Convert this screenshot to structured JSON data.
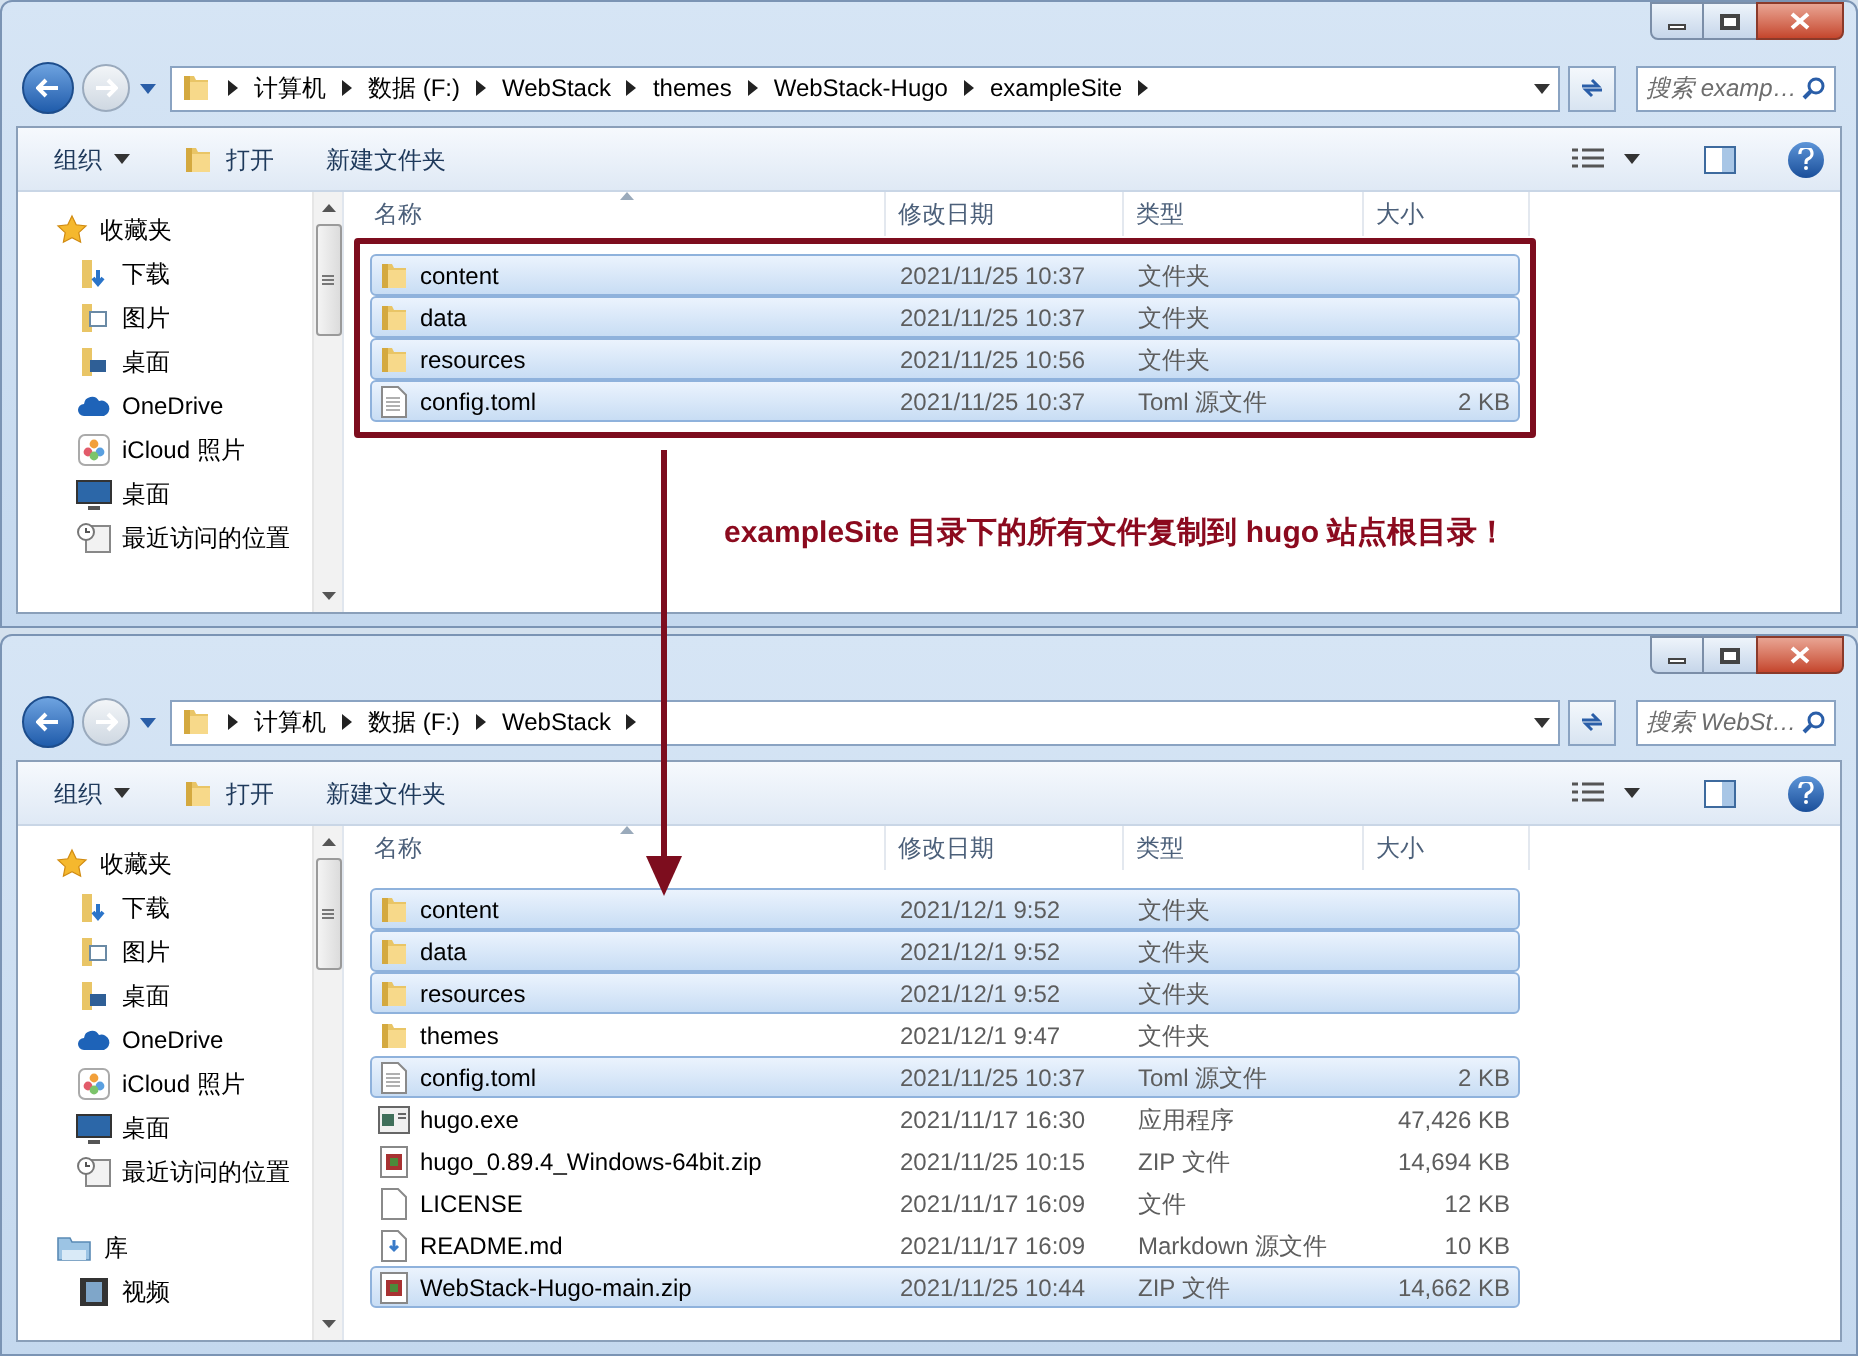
{
  "windows": [
    {
      "breadcrumbs": [
        "计算机",
        "数据 (F:)",
        "WebStack",
        "themes",
        "WebStack-Hugo",
        "exampleSite"
      ],
      "search": {
        "placeholder": "搜索 examp…"
      },
      "toolbar": [
        {
          "label": "组织",
          "kind": "menu"
        },
        {
          "label": "打开",
          "kind": "open"
        },
        {
          "label": "新建文件夹",
          "kind": "plain"
        }
      ],
      "nav": [
        {
          "label": "收藏夹",
          "kind": "star",
          "children": [
            {
              "label": "下载",
              "kind": "download"
            },
            {
              "label": "图片",
              "kind": "pictures"
            },
            {
              "label": "桌面",
              "kind": "desktop-folder"
            },
            {
              "label": "OneDrive",
              "kind": "cloud"
            },
            {
              "label": "iCloud 照片",
              "kind": "photos"
            },
            {
              "label": "桌面",
              "kind": "monitor"
            },
            {
              "label": "最近访问的位置",
              "kind": "recent"
            }
          ]
        }
      ],
      "columns": [
        "名称",
        "修改日期",
        "类型",
        "大小"
      ],
      "highlight": true,
      "rows": [
        {
          "name": "content",
          "kind": "folder",
          "date": "2021/11/25 10:37",
          "type": "文件夹",
          "selected": true
        },
        {
          "name": "data",
          "kind": "folder",
          "date": "2021/11/25 10:37",
          "type": "文件夹",
          "selected": true
        },
        {
          "name": "resources",
          "kind": "folder",
          "date": "2021/11/25 10:56",
          "type": "文件夹",
          "selected": true
        },
        {
          "name": "config.toml",
          "kind": "document",
          "date": "2021/11/25 10:37",
          "type": "Toml 源文件",
          "size": "2 KB",
          "selected": true
        }
      ]
    },
    {
      "breadcrumbs": [
        "计算机",
        "数据 (F:)",
        "WebStack"
      ],
      "search": {
        "placeholder": "搜索 WebSt…"
      },
      "toolbar": [
        {
          "label": "组织",
          "kind": "menu"
        },
        {
          "label": "打开",
          "kind": "open"
        },
        {
          "label": "新建文件夹",
          "kind": "plain"
        }
      ],
      "nav": [
        {
          "label": "收藏夹",
          "kind": "star",
          "children": [
            {
              "label": "下载",
              "kind": "download"
            },
            {
              "label": "图片",
              "kind": "pictures"
            },
            {
              "label": "桌面",
              "kind": "desktop-folder"
            },
            {
              "label": "OneDrive",
              "kind": "cloud"
            },
            {
              "label": "iCloud 照片",
              "kind": "photos"
            },
            {
              "label": "桌面",
              "kind": "monitor"
            },
            {
              "label": "最近访问的位置",
              "kind": "recent"
            }
          ]
        },
        {
          "label": "库",
          "kind": "library",
          "children": [
            {
              "label": "视频",
              "kind": "video"
            }
          ]
        }
      ],
      "columns": [
        "名称",
        "修改日期",
        "类型",
        "大小"
      ],
      "highlight": false,
      "rows": [
        {
          "name": "content",
          "kind": "folder",
          "date": "2021/12/1 9:52",
          "type": "文件夹",
          "selected": true
        },
        {
          "name": "data",
          "kind": "folder",
          "date": "2021/12/1 9:52",
          "type": "文件夹",
          "selected": true
        },
        {
          "name": "resources",
          "kind": "folder",
          "date": "2021/12/1 9:52",
          "type": "文件夹",
          "selected": true
        },
        {
          "name": "themes",
          "kind": "folder",
          "date": "2021/12/1 9:47",
          "type": "文件夹",
          "selected": false
        },
        {
          "name": "config.toml",
          "kind": "document",
          "date": "2021/11/25 10:37",
          "type": "Toml 源文件",
          "size": "2 KB",
          "selected": true
        },
        {
          "name": "hugo.exe",
          "kind": "application",
          "date": "2021/11/17 16:30",
          "type": "应用程序",
          "size": "47,426 KB",
          "selected": false
        },
        {
          "name": "hugo_0.89.4_Windows-64bit.zip",
          "kind": "archive",
          "date": "2021/11/25 10:15",
          "type": "ZIP 文件",
          "size": "14,694 KB",
          "selected": false
        },
        {
          "name": "LICENSE",
          "kind": "blank",
          "date": "2021/11/17 16:09",
          "type": "文件",
          "size": "12 KB",
          "selected": false
        },
        {
          "name": "README.md",
          "kind": "markdown",
          "date": "2021/11/17 16:09",
          "type": "Markdown 源文件",
          "size": "10 KB",
          "selected": false
        },
        {
          "name": "WebStack-Hugo-main.zip",
          "kind": "archive",
          "date": "2021/11/25 10:44",
          "type": "ZIP 文件",
          "size": "14,662 KB",
          "selected": true
        }
      ]
    }
  ],
  "annotation": {
    "text": "exampleSite 目录下的所有文件复制到 hugo 站点根目录！"
  }
}
